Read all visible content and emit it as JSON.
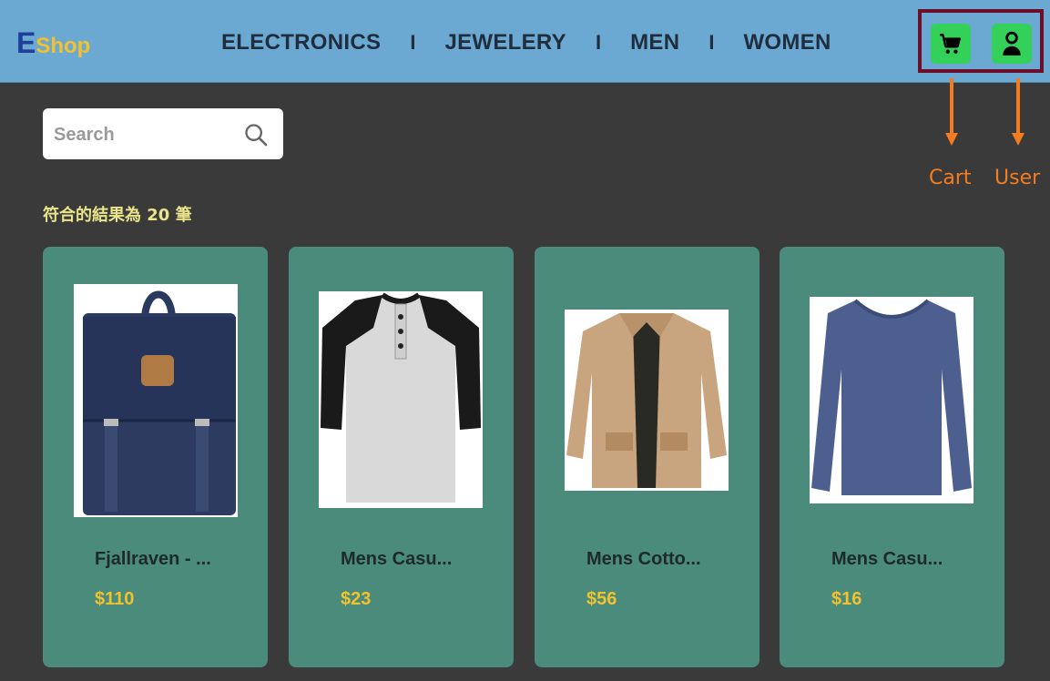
{
  "logo": {
    "first": "E",
    "rest": "Shop"
  },
  "nav": {
    "items": [
      "ELECTRONICS",
      "JEWELERY",
      "MEN",
      "WOMEN"
    ],
    "separator": "I"
  },
  "header_icons": {
    "cart": "cart-icon",
    "user": "user-icon"
  },
  "annotations": {
    "cart": "Cart",
    "user": "User"
  },
  "search": {
    "placeholder": "Search",
    "value": ""
  },
  "results_text": "符合的結果為 20 筆",
  "products": [
    {
      "name": "Fjallraven - ...",
      "price": "$110",
      "image": "backpack"
    },
    {
      "name": "Mens Casu...",
      "price": "$23",
      "image": "raglan-tshirt"
    },
    {
      "name": "Mens Cotto...",
      "price": "$56",
      "image": "jacket"
    },
    {
      "name": "Mens Casu...",
      "price": "$16",
      "image": "long-sleeve-shirt"
    }
  ],
  "colors": {
    "header": "#6ba8d2",
    "background": "#3a3a3a",
    "card": "#4a8b7c",
    "price": "#f2c12e",
    "icon_button": "#34d15a",
    "annotation": "#f47c20",
    "highlight_box": "#6b0f2a"
  }
}
